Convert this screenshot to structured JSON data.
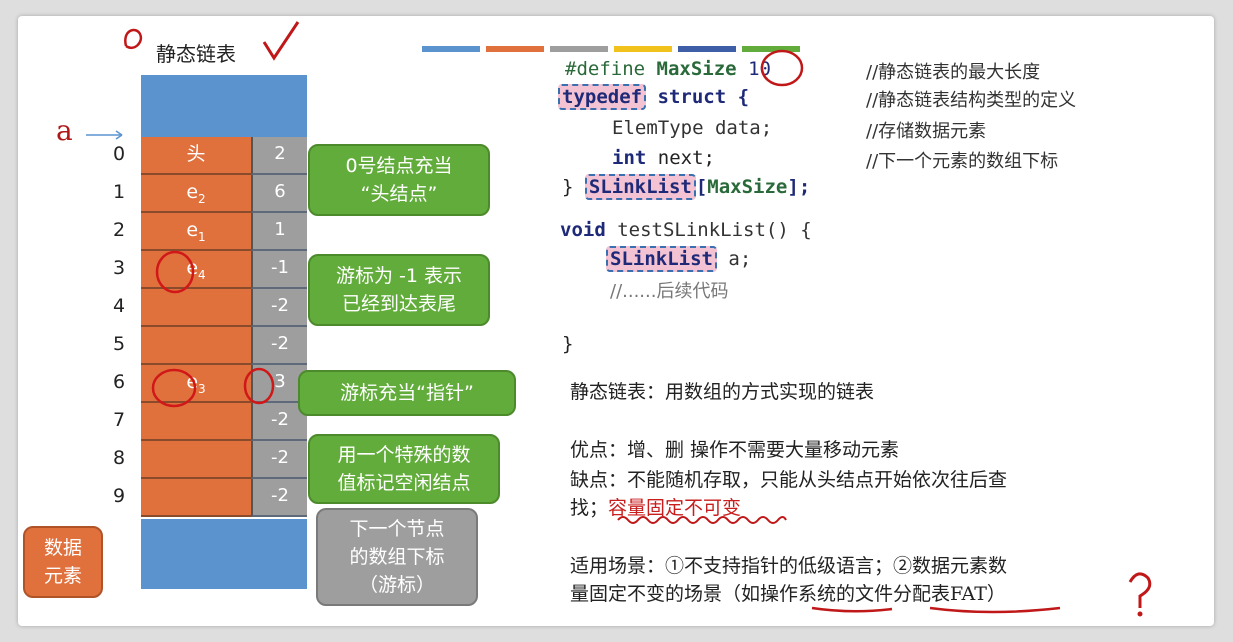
{
  "title": "静态链表",
  "arrow_label": "a",
  "rows": [
    {
      "index": "0",
      "data": "头",
      "sub": "",
      "cursor": "2"
    },
    {
      "index": "1",
      "data": "e",
      "sub": "2",
      "cursor": "6"
    },
    {
      "index": "2",
      "data": "e",
      "sub": "1",
      "cursor": "1"
    },
    {
      "index": "3",
      "data": "e",
      "sub": "4",
      "cursor": "-1"
    },
    {
      "index": "4",
      "data": "",
      "sub": "",
      "cursor": "-2"
    },
    {
      "index": "5",
      "data": "",
      "sub": "",
      "cursor": "-2"
    },
    {
      "index": "6",
      "data": "e",
      "sub": "3",
      "cursor": "3"
    },
    {
      "index": "7",
      "data": "",
      "sub": "",
      "cursor": "-2"
    },
    {
      "index": "8",
      "data": "",
      "sub": "",
      "cursor": "-2"
    },
    {
      "index": "9",
      "data": "",
      "sub": "",
      "cursor": "-2"
    }
  ],
  "callouts": {
    "head_line1": "0号结点充当",
    "head_line2": "“头结点”",
    "tail_line1": "游标为 -1 表示",
    "tail_line2": "已经到达表尾",
    "pointer": "游标充当“指针”",
    "free_line1": "用一个特殊的数",
    "free_line2": "值标记空闲结点",
    "next_line1": "下一个节点",
    "next_line2": "的数组下标",
    "next_line3": "（游标）",
    "data_line1": "数据",
    "data_line2": "元素"
  },
  "code": {
    "define_kw": "#define",
    "define_name": "MaxSize",
    "define_value": "10",
    "define_comment": "//静态链表的最大长度",
    "typedef_kw": "typedef",
    "struct_open": " struct {",
    "typedef_comment": "//静态链表结构类型的定义",
    "field1": "ElemType data;",
    "field1_comment": "//存储数据元素",
    "field2_type": "int",
    "field2_name": " next;",
    "field2_comment": "//下一个元素的数组下标",
    "close_brace": "} ",
    "type_name": "SLinkList",
    "array_part_open": "[",
    "array_part_name": "MaxSize",
    "array_part_close": "];",
    "void_kw": "void",
    "func_sig": " testSLinkList() {",
    "decl_type": "SLinkList",
    "decl_var": " a;",
    "later_comment": "//......后续代码",
    "func_close": "}"
  },
  "notes": {
    "definition": "静态链表：用数组的方式实现的链表",
    "pros": "优点：增、删 操作不需要大量移动元素",
    "cons_line1": "缺点：不能随机存取，只能从头结点开始依次往后查",
    "cons_line2_prefix": "找；",
    "cons_line2_red": "容量固定不可变",
    "usage_line1": "适用场景：①不支持指针的低级语言；②数据元素数",
    "usage_line2": "量固定不变的场景（如操作系统的文件分配表FAT）"
  },
  "stripe_colors": [
    "#5b93cf",
    "#e0703c",
    "#9e9e9e",
    "#f2c21c",
    "#3f5ea8",
    "#62ac3c"
  ]
}
